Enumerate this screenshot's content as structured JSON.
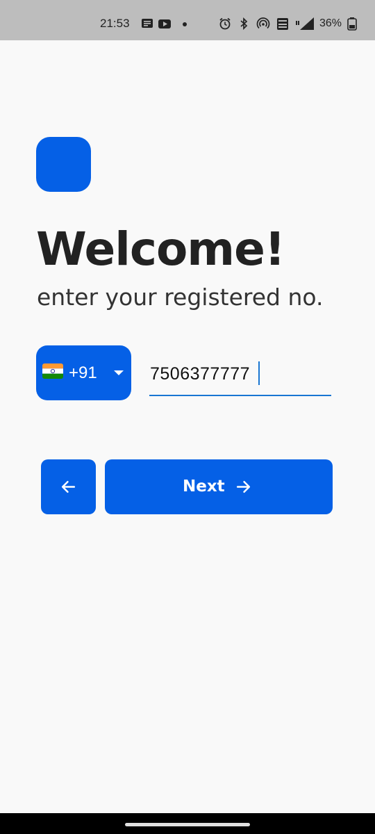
{
  "status_bar": {
    "time": "21:53",
    "battery": "36%",
    "icons": [
      "message-icon",
      "youtube-icon",
      "dot-icon",
      "alarm-icon",
      "bluetooth-icon",
      "hotspot-icon",
      "volte-icon",
      "signal-4g-icon",
      "battery-icon"
    ]
  },
  "welcome": {
    "title": "Welcome!",
    "subtitle": "enter your registered no."
  },
  "phone": {
    "country_flag": "india-flag-icon",
    "country_code": "+91",
    "number": "7506377777"
  },
  "actions": {
    "back_icon": "arrow-left-icon",
    "next_label": "Next",
    "next_icon": "arrow-right-icon"
  },
  "colors": {
    "primary": "#0560e6",
    "focus_underline": "#1976d2",
    "background": "#f9f9f9"
  }
}
